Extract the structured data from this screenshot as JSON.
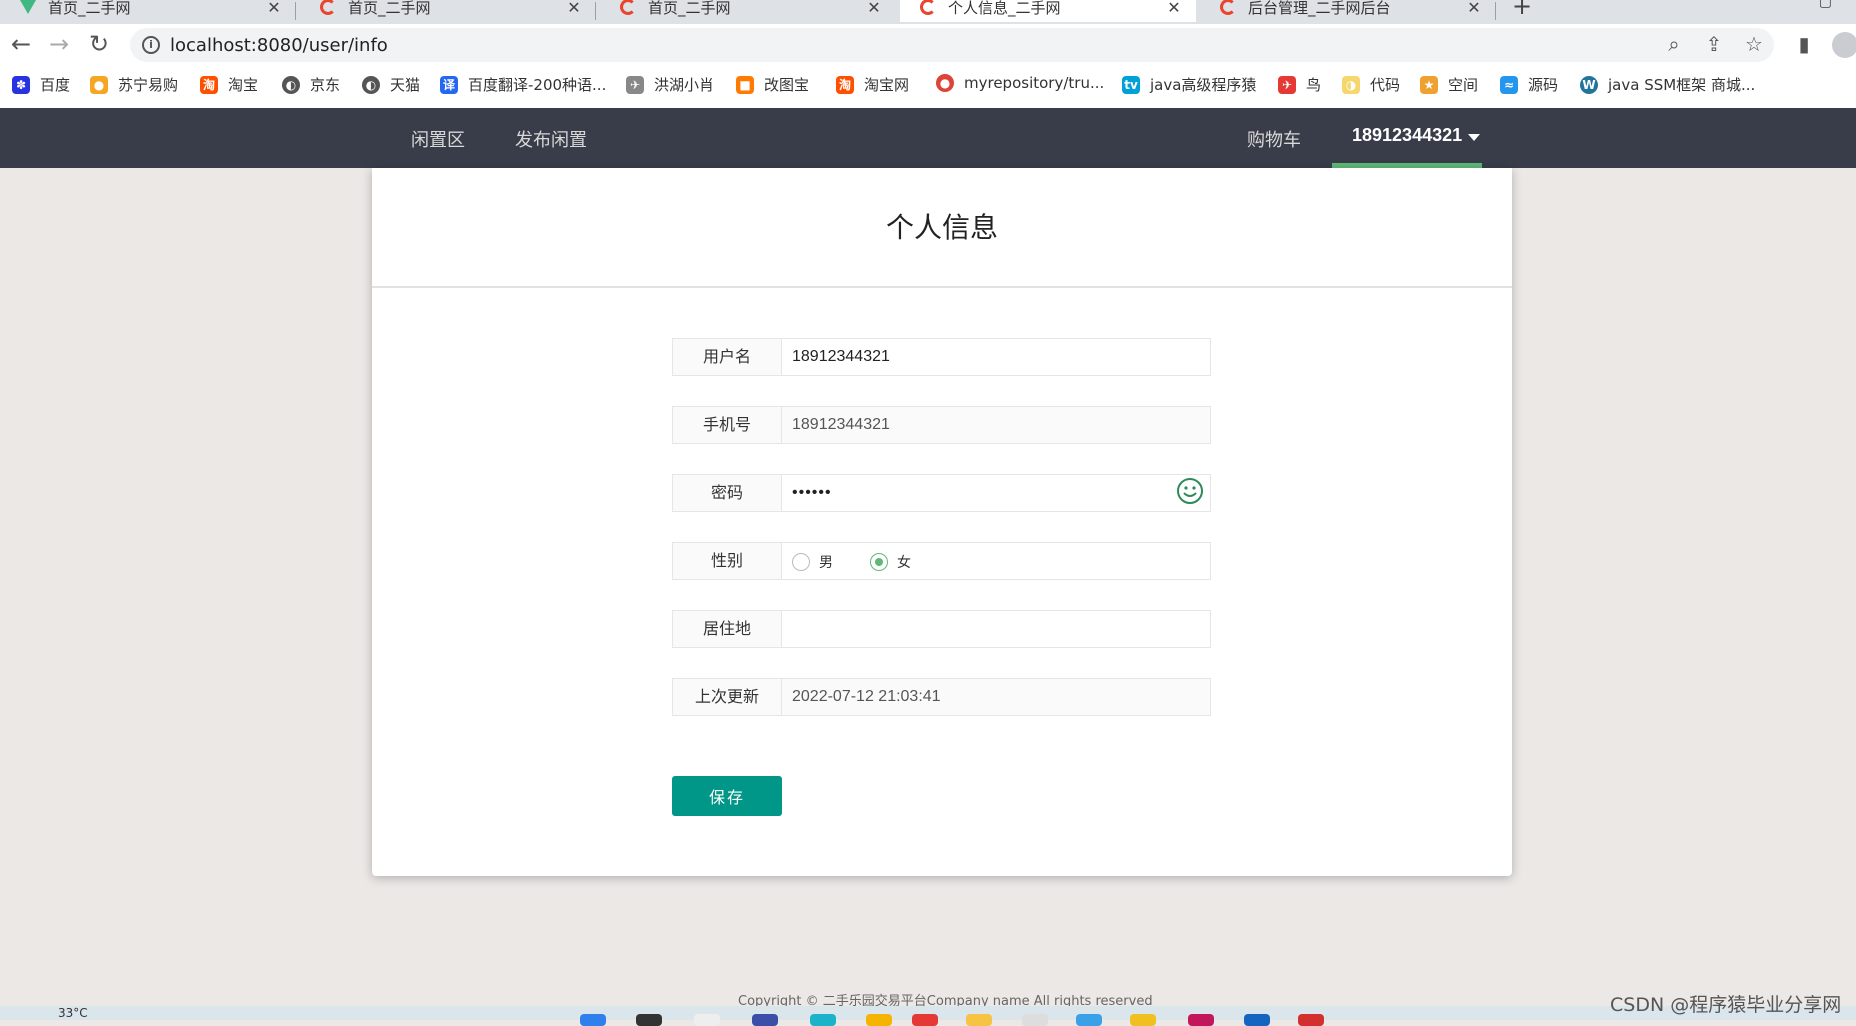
{
  "browser": {
    "tabs": [
      {
        "title": "首页_二手网",
        "favicon": "vue-logo-icon",
        "active": false
      },
      {
        "title": "首页_二手网",
        "favicon": "site-c-icon",
        "active": false
      },
      {
        "title": "首页_二手网",
        "favicon": "site-c-icon",
        "active": false
      },
      {
        "title": "个人信息_二手网",
        "favicon": "site-c-icon",
        "active": true
      },
      {
        "title": "后台管理_二手网后台",
        "favicon": "site-c-icon",
        "active": false
      }
    ],
    "url": "localhost:8080/user/info",
    "bookmarks": [
      {
        "label": "百度",
        "icon": "baidu-icon",
        "color": "#2932e1"
      },
      {
        "label": "苏宁易购",
        "icon": "suning-icon",
        "color": "#f5a623"
      },
      {
        "label": "淘宝",
        "icon": "taobao-icon",
        "color": "#ff5000"
      },
      {
        "label": "京东",
        "icon": "globe-icon",
        "color": "#555555"
      },
      {
        "label": "天猫",
        "icon": "globe-icon",
        "color": "#555555"
      },
      {
        "label": "百度翻译-200种语...",
        "icon": "translate-icon",
        "color": "#2468f2"
      },
      {
        "label": "洪湖小肖",
        "icon": "bird-icon",
        "color": "#888888"
      },
      {
        "label": "改图宝",
        "icon": "gaitubao-icon",
        "color": "#ff7a00"
      },
      {
        "label": "淘宝网",
        "icon": "taobao-icon",
        "color": "#ff5000"
      },
      {
        "label": "myrepository/tru...",
        "icon": "chrome-icon",
        "color": "#db4437"
      },
      {
        "label": "java高级程序猿",
        "icon": "bilibili-icon",
        "color": "#00a1d6"
      },
      {
        "label": "鸟",
        "icon": "bird-icon",
        "color": "#e53935"
      },
      {
        "label": "代码",
        "icon": "code-icon",
        "color": "#f5d76e"
      },
      {
        "label": "空间",
        "icon": "qzone-icon",
        "color": "#f0a030"
      },
      {
        "label": "源码",
        "icon": "docker-icon",
        "color": "#2496ed"
      },
      {
        "label": "java SSM框架 商城...",
        "icon": "wordpress-icon",
        "color": "#21759b"
      }
    ]
  },
  "nav": {
    "links": [
      "闲置区",
      "发布闲置"
    ],
    "cart": "购物车",
    "user": "18912344321"
  },
  "page": {
    "title": "个人信息",
    "fields": {
      "username": {
        "label": "用户名",
        "value": "18912344321"
      },
      "phone": {
        "label": "手机号",
        "value": "18912344321"
      },
      "password": {
        "label": "密码",
        "value": "••••••"
      },
      "gender": {
        "label": "性别",
        "options": [
          "男",
          "女"
        ],
        "selected": "女"
      },
      "address": {
        "label": "居住地",
        "value": ""
      },
      "updated": {
        "label": "上次更新",
        "value": "2022-07-12 21:03:41"
      }
    },
    "save": "保存"
  },
  "footer": {
    "copyright": "Copyright © 二手乐园交易平台Company name All rights reserved"
  },
  "taskbar": {
    "weather": "33°C"
  },
  "watermark": "CSDN @程序猿毕业分享网",
  "colors": {
    "nav_bg": "#393d49",
    "nav_active": "#5fb878",
    "primary_button": "#009688"
  }
}
